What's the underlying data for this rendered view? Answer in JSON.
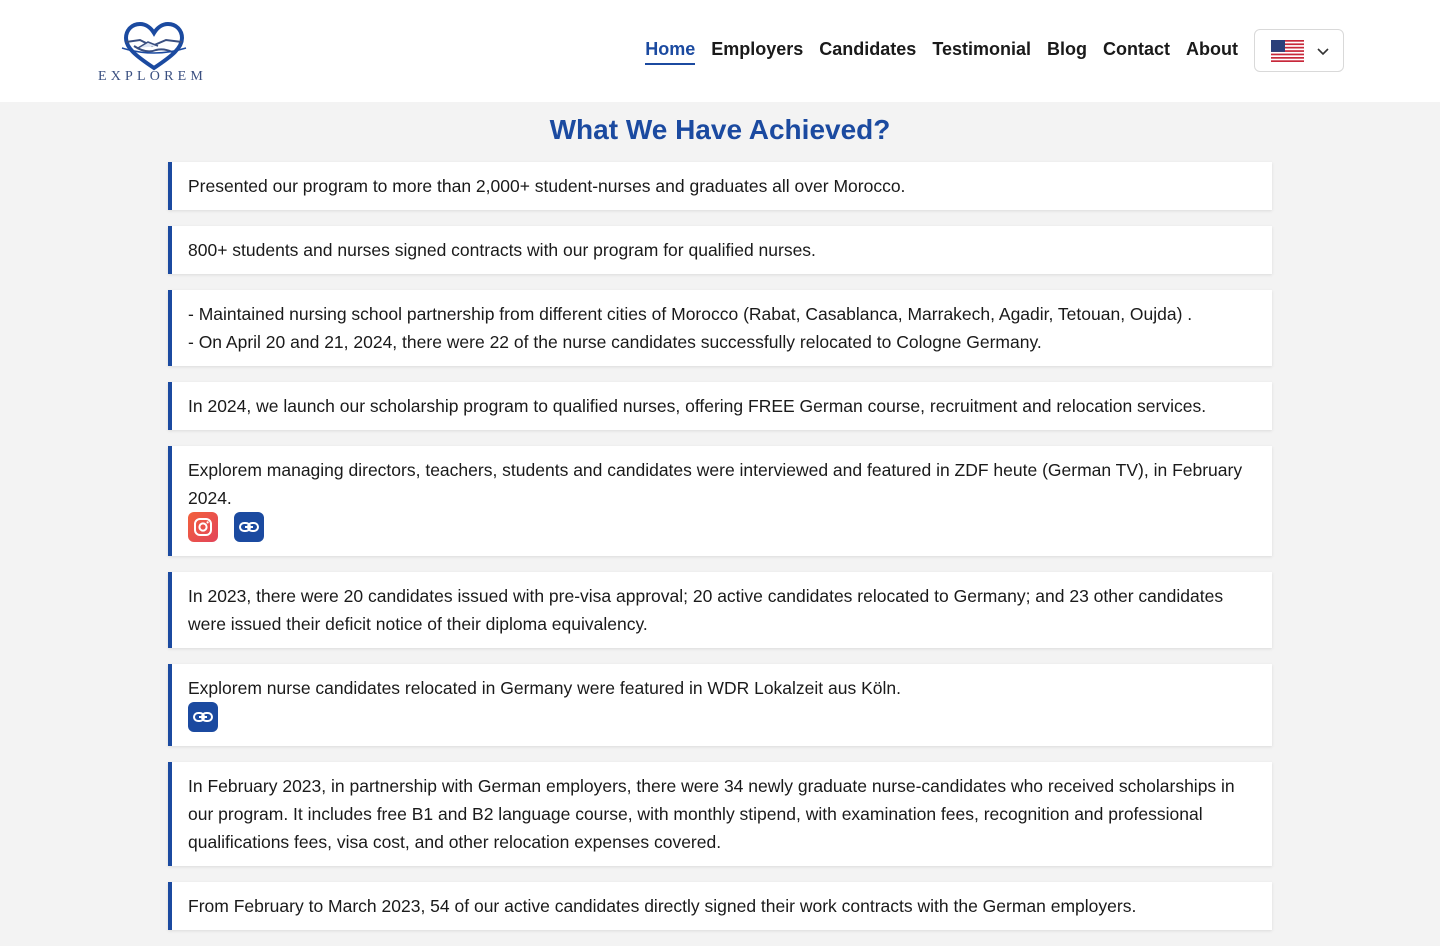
{
  "brand": {
    "logo_text": "EXPLOREM"
  },
  "nav": {
    "items": [
      {
        "label": "Home",
        "active": true
      },
      {
        "label": "Employers"
      },
      {
        "label": "Candidates"
      },
      {
        "label": "Testimonial"
      },
      {
        "label": "Blog"
      },
      {
        "label": "Contact"
      },
      {
        "label": "About"
      }
    ],
    "language": {
      "flag": "us-flag-icon"
    }
  },
  "section": {
    "title": "What We Have Achieved?",
    "achievements": [
      {
        "lines": [
          "Presented our program to more than 2,000+ student-nurses and graduates all over Morocco."
        ]
      },
      {
        "lines": [
          "800+ students and nurses signed contracts with our program for qualified nurses."
        ]
      },
      {
        "lines": [
          "- Maintained nursing school partnership from different cities of Morocco (Rabat, Casablanca, Marrakech, Agadir, Tetouan, Oujda) .",
          "- On April 20 and 21, 2024, there were 22 of the nurse candidates successfully relocated to Cologne Germany."
        ]
      },
      {
        "lines": [
          "In 2024, we launch our scholarship program to qualified nurses, offering FREE German course, recruitment and relocation services."
        ]
      },
      {
        "lines": [
          "Explorem managing directors, teachers, students and candidates were interviewed and featured in ZDF heute (German TV), in February 2024."
        ],
        "icons": [
          "instagram-icon",
          "link-icon"
        ]
      },
      {
        "lines": [
          "In 2023, there were 20 candidates issued with pre-visa approval; 20 active candidates relocated to Germany; and 23 other candidates were issued their deficit notice of their diploma equivalency."
        ]
      },
      {
        "lines": [
          "Explorem nurse candidates relocated in Germany were featured in WDR Lokalzeit aus Köln."
        ],
        "icons": [
          "link-icon"
        ]
      },
      {
        "lines": [
          "In February 2023, in partnership with German employers, there were 34 newly graduate nurse-candidates who received scholarships in our program. It includes free B1 and B2 language course, with monthly stipend, with examination fees, recognition and professional qualifications fees, visa cost, and other relocation expenses covered."
        ]
      },
      {
        "lines": [
          "From February to March 2023, 54 of our active candidates directly signed their work contracts with the German employers."
        ]
      }
    ]
  },
  "colors": {
    "accent": "#1b4aa0",
    "background": "#f3f3f3",
    "instagram": "#f2613c"
  }
}
